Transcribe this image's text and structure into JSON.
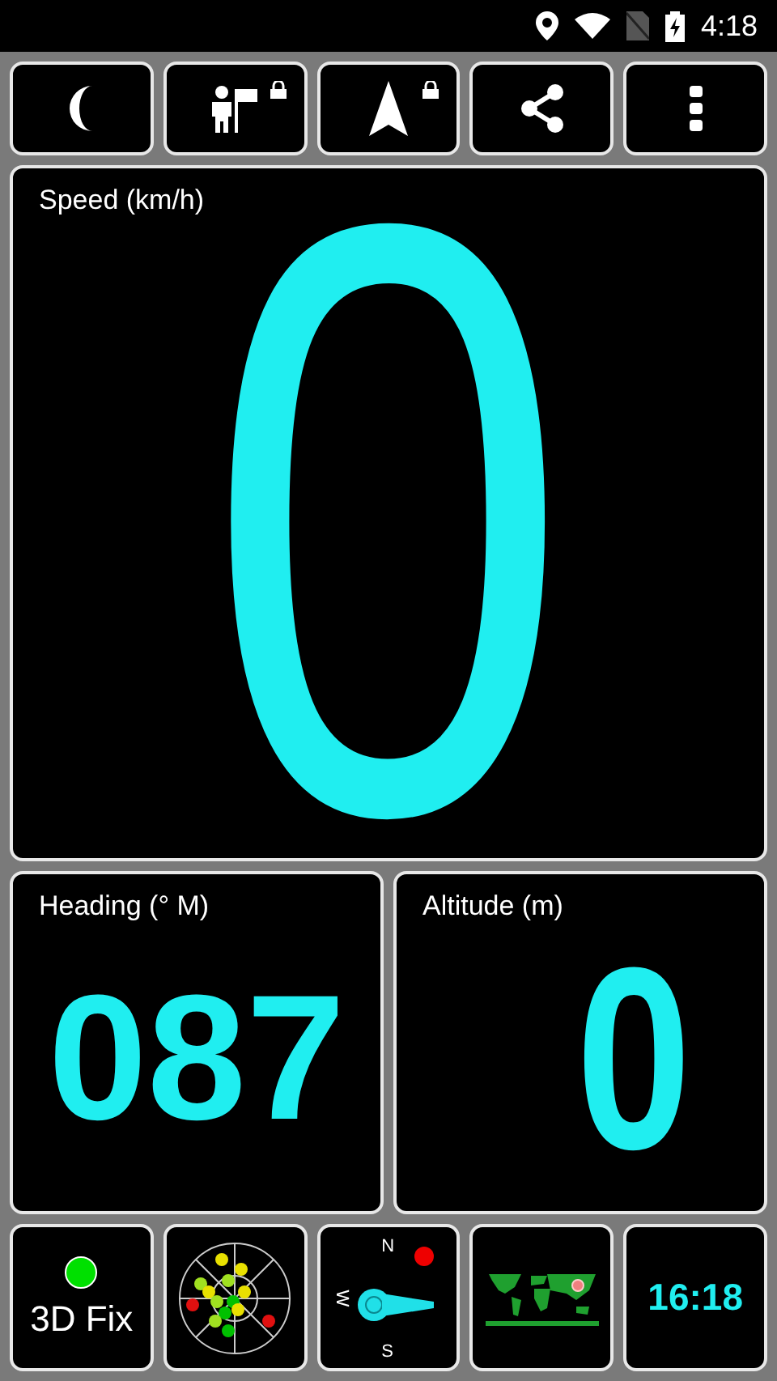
{
  "status_bar": {
    "time": "4:18"
  },
  "toolbar": [
    {
      "kind": "night",
      "locked": false
    },
    {
      "kind": "waypoint",
      "locked": true
    },
    {
      "kind": "navigate",
      "locked": true
    },
    {
      "kind": "share",
      "locked": false
    },
    {
      "kind": "menu",
      "locked": false
    }
  ],
  "speed": {
    "label": "Speed (km/h)",
    "value": "0"
  },
  "heading": {
    "label": "Heading (° M)",
    "value": "087"
  },
  "altitude": {
    "label": "Altitude (m)",
    "value": "0"
  },
  "bottom": [
    {
      "kind": "fix",
      "label": "3D Fix",
      "color": "#00e000"
    },
    {
      "kind": "sky"
    },
    {
      "kind": "compass",
      "north": "N",
      "west": "W",
      "south": "S"
    },
    {
      "kind": "map"
    },
    {
      "kind": "clock",
      "time": "16:18"
    }
  ]
}
